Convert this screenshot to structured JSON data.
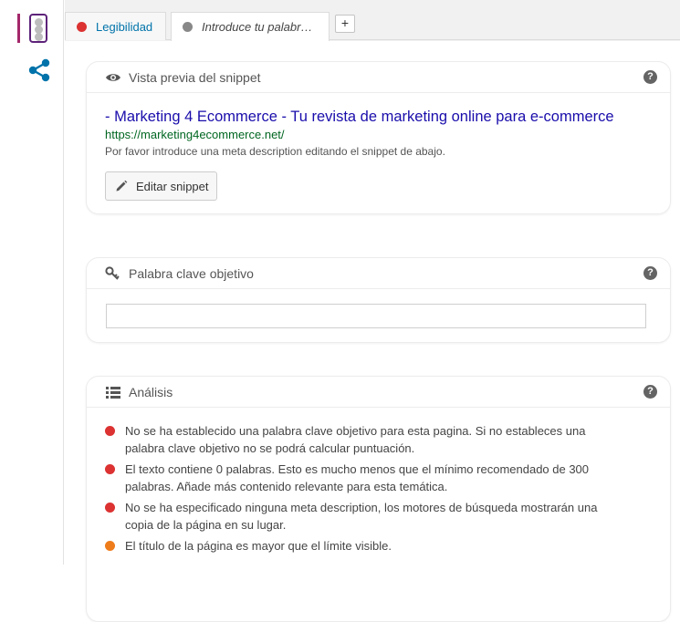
{
  "colors": {
    "bad": "#dc3232",
    "ok": "#ee7c1b",
    "neutral": "#888888",
    "link": "#1a0dab",
    "url": "#006621",
    "accent": "#a4286a"
  },
  "sidebar": {
    "items": [
      {
        "icon": "traffic-light-icon",
        "active": true
      },
      {
        "icon": "share-icon",
        "active": false
      }
    ]
  },
  "tabs": [
    {
      "label": "Legibilidad",
      "status": "bad"
    },
    {
      "label": "Introduce tu palabra ...",
      "status": "neutral"
    }
  ],
  "add_tab_label": "+",
  "snippet": {
    "header": "Vista previa del snippet",
    "title": "- Marketing 4 Ecommerce - Tu revista de marketing online para e-commerce",
    "url": "https://marketing4ecommerce.net/",
    "description": "Por favor introduce una meta description editando el snippet de abajo.",
    "edit_button": "Editar snippet",
    "help": "?"
  },
  "keyword": {
    "header": "Palabra clave objetivo",
    "value": "",
    "help": "?"
  },
  "analysis": {
    "header": "Análisis",
    "help": "?",
    "items": [
      {
        "status": "bad",
        "text": "No se ha establecido una palabra clave objetivo para esta pagina. Si no estableces una palabra clave objetivo no se podrá calcular puntuación."
      },
      {
        "status": "bad",
        "text": "El texto contiene 0 palabras. Esto es mucho menos que el mínimo recomendado de 300 palabras. Añade más contenido relevante para esta temática."
      },
      {
        "status": "bad",
        "text": "No se ha especificado ninguna meta description, los motores de búsqueda mostrarán una copia de la página en su lugar."
      },
      {
        "status": "ok",
        "text": "El título de la página es mayor que el límite visible."
      }
    ]
  }
}
